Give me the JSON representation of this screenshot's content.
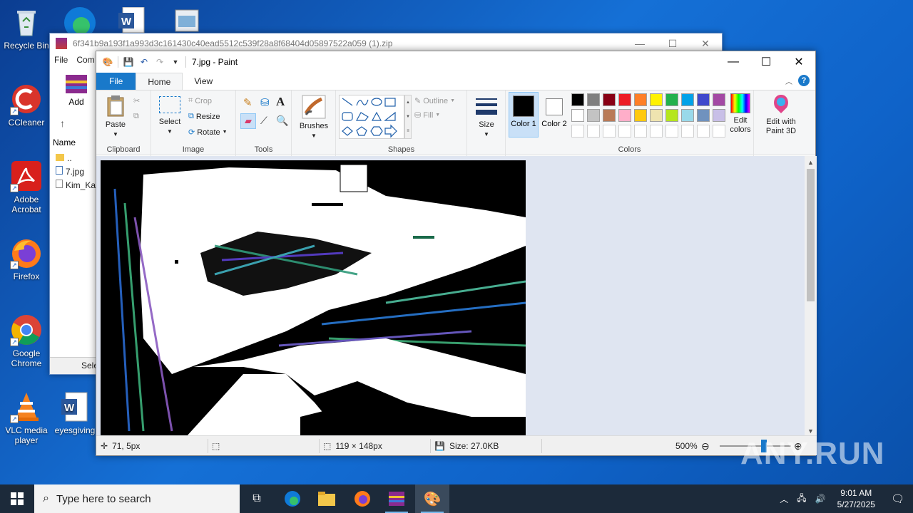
{
  "desktop": {
    "icons": [
      {
        "label": "Recycle Bin"
      },
      {
        "label": "CCleaner"
      },
      {
        "label": "Adobe Acrobat"
      },
      {
        "label": "Firefox"
      },
      {
        "label": "Google Chrome"
      },
      {
        "label": "VLC media player"
      },
      {
        "label": "eyesgiving"
      }
    ]
  },
  "winrar": {
    "title": "6f341b9a193f1a993d3c161430c40ead5512c539f28a8f68404d05897522a059 (1).zip",
    "menu": [
      "File",
      "Com"
    ],
    "add_label": "Add",
    "column_name": "Name",
    "files": [
      "..",
      "7.jpg",
      "Kim_Ka"
    ],
    "status": "Sele"
  },
  "paint": {
    "title": "7.jpg - Paint",
    "tabs": {
      "file": "File",
      "home": "Home",
      "view": "View"
    },
    "clipboard": {
      "paste": "Paste",
      "group": "Clipboard"
    },
    "image": {
      "select": "Select",
      "crop": "Crop",
      "resize": "Resize",
      "rotate": "Rotate",
      "group": "Image"
    },
    "tools": {
      "group": "Tools"
    },
    "brushes": {
      "label": "Brushes"
    },
    "shapes": {
      "outline": "Outline",
      "fill": "Fill",
      "group": "Shapes"
    },
    "size": {
      "label": "Size"
    },
    "colors": {
      "color1": "Color 1",
      "color2": "Color 2",
      "edit": "Edit colors",
      "paint3d": "Edit with Paint 3D",
      "group": "Colors",
      "palette_row1": [
        "#000000",
        "#7f7f7f",
        "#880015",
        "#ed1c24",
        "#ff7f27",
        "#fff200",
        "#22b14c",
        "#00a2e8",
        "#3f48cc",
        "#a349a4"
      ],
      "palette_row2": [
        "#ffffff",
        "#c3c3c3",
        "#b97a57",
        "#ffaec9",
        "#ffc90e",
        "#efe4b0",
        "#b5e61d",
        "#99d9ea",
        "#7092be",
        "#c8bfe7"
      ]
    },
    "status": {
      "cursor": "71, 5px",
      "selection": "119 × 148px",
      "size": "Size: 27.0KB",
      "zoom": "500%"
    }
  },
  "taskbar": {
    "search_placeholder": "Type here to search",
    "time": "9:01 AM",
    "date": "5/27/2025"
  },
  "watermark": "ANY.RUN"
}
